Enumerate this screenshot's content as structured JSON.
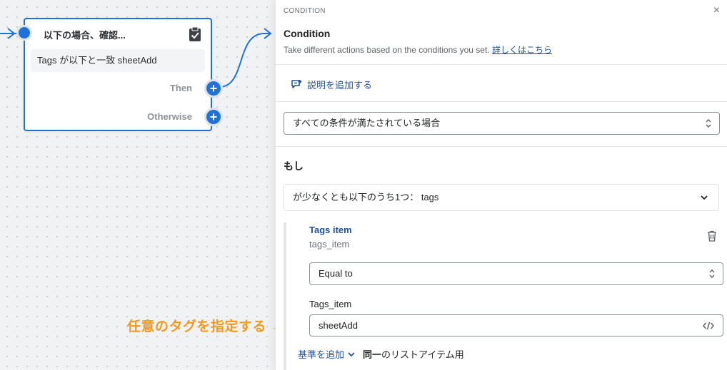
{
  "canvas": {
    "node": {
      "title": "以下の場合、確認...",
      "condition_text": "Tags が以下と一致 sheetAdd",
      "then_label": "Then",
      "otherwise_label": "Otherwise"
    }
  },
  "panel": {
    "section_label": "CONDITION",
    "close_glyph": "×",
    "title": "Condition",
    "description": "Take different actions based on the conditions you set.",
    "learn_more": "詳しくはこちら",
    "add_description": "説明を追加する",
    "match_mode": "すべての条件が満たされている場合",
    "if_label": "もし",
    "group_header": "が少なくとも以下のうち1つ： tags",
    "field": {
      "title": "Tags item",
      "subtitle": "tags_item",
      "operator": "Equal to",
      "value_label": "Tags_item",
      "value": "sheetAdd"
    },
    "add_criteria": "基準を追加",
    "same_prefix": "同一",
    "same_suffix": "のリストアイテム用"
  },
  "annotation": {
    "text": "任意のタグを指定する",
    "arrow": "→"
  },
  "colors": {
    "accent_blue": "#1f73d8",
    "link_blue": "#1f5199",
    "annotation_orange": "#f39a1e",
    "canvas_bg": "#f1f2f3"
  },
  "icons": {
    "node_dot": "circle-dot-icon",
    "clipboard": "clipboard-check-icon",
    "plus": "plus-icon",
    "close": "close-icon",
    "comment_add": "comment-add-icon",
    "updown": "select-arrows-icon",
    "chevron": "chevron-down-icon",
    "trash": "trash-icon",
    "code": "code-icon"
  }
}
